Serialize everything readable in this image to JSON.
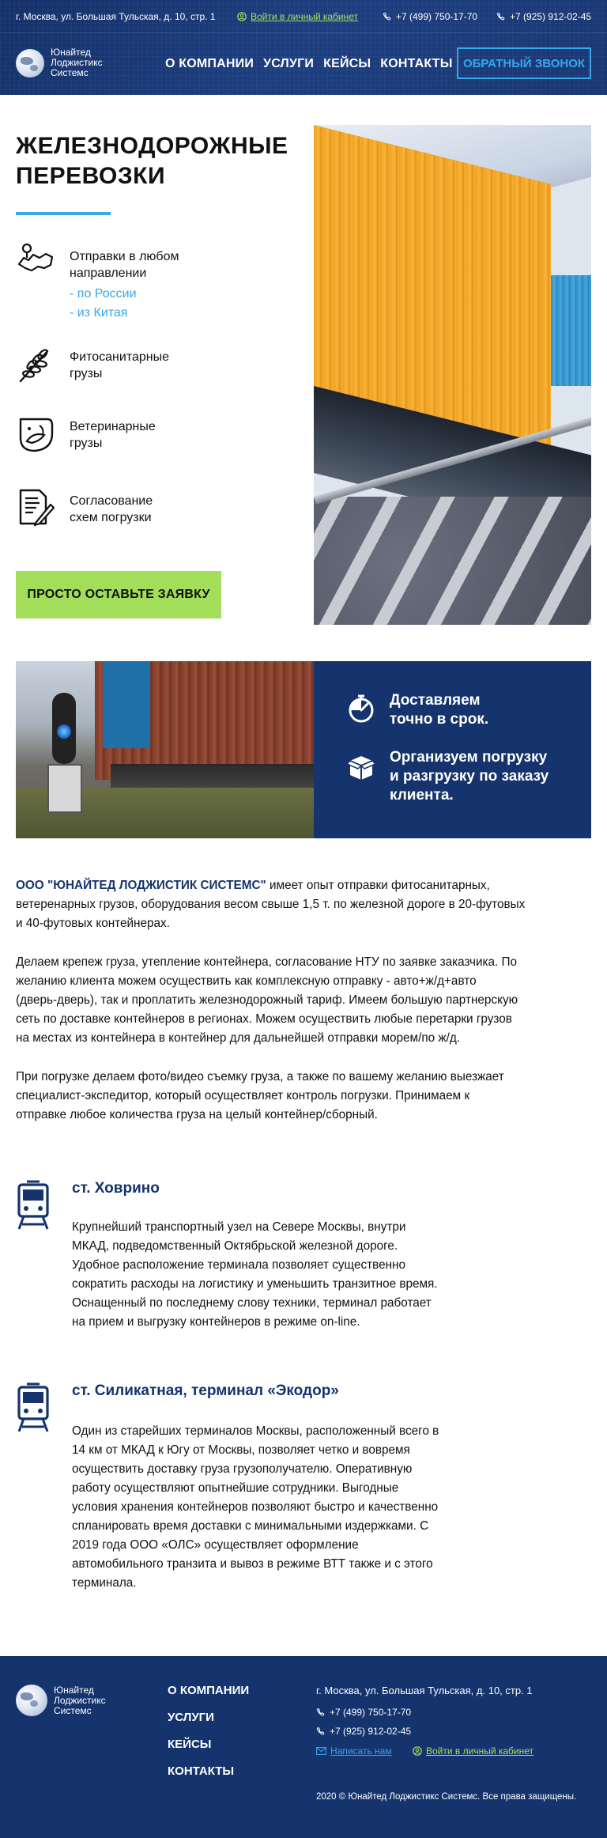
{
  "topbar": {
    "address": "г. Москва, ул. Большая Тульская, д. 10, стр. 1",
    "login": "Войти в личный кабинет",
    "phone1": "+7 (499) 750-17-70",
    "phone2": "+7 (925) 912-02-45"
  },
  "logo": {
    "line1": "Юнайтед",
    "line2": "Лоджистикс",
    "line3": "Системс"
  },
  "nav": [
    "О КОМПАНИИ",
    "УСЛУГИ",
    "КЕЙСЫ",
    "КОНТАКТЫ"
  ],
  "callback_button": "ОБРАТНЫЙ ЗВОНОК",
  "hero": {
    "title_line1": "ЖЕЛЕЗНОДОРОЖНЫЕ",
    "title_line2": "ПЕРЕВОЗКИ",
    "features": [
      {
        "icon": "map-icon",
        "line1": "Отправки в любом",
        "line2": "направлении",
        "sub1": "- по России",
        "sub2": "- из Китая"
      },
      {
        "icon": "wheat-icon",
        "line1": "Фитосанитарные",
        "line2": "грузы"
      },
      {
        "icon": "fish-icon",
        "line1": "Ветеринарные",
        "line2": "грузы"
      },
      {
        "icon": "document-icon",
        "line1": "Согласование",
        "line2": "схем погрузки"
      }
    ],
    "cta": "ПРОСТО ОСТАВЬТЕ ЗАЯВКУ"
  },
  "banner": {
    "item1_line1": "Доставляем",
    "item1_line2": "точно в срок.",
    "item2_line1": "Организуем погрузку",
    "item2_line2": "и разгрузку по заказу",
    "item2_line3": "клиента."
  },
  "text": {
    "p1_brand": "ООО \"ЮНАЙТЕД ЛОДЖИСТИК СИСТЕМС\"",
    "p1_line1_rest": " имеет опыт отправки фитосанитарных,",
    "p1_line2": "ветеренарных грузов, оборудования весом свыше 1,5 т. по железной дороге в 20-футовых",
    "p1_line3": "и 40-футовых контейнерах.",
    "p2_line1": "Делаем крепеж груза, утепление контейнера, согласование НТУ по заявке заказчика. По",
    "p2_line2": "желанию клиента можем осуществить как комплексную отправку - авто+ж/д+авто",
    "p2_line3": "(дверь-дверь), так и проплатить железнодорожный тариф. Имеем большую партнерскую",
    "p2_line4": "сеть по доставке контейнеров в регионах. Можем осуществить любые перетарки грузов",
    "p2_line5": "на местах из контейнера в контейнер для дальнейшей отправки морем/по ж/д.",
    "p3_line1": "При погрузке делаем фото/видео съемку груза, а также по вашему желанию выезжает",
    "p3_line2": "специалист-экспедитор, который осуществляет контроль погрузки. Принимаем к",
    "p3_line3": "отправке любое количества груза на целый контейнер/сборный."
  },
  "stations": [
    {
      "title": "ст. Ховрино",
      "lines": [
        "Крупнейший транспортный узел на Севере Москвы, внутри",
        "МКАД, подведомственный Октябрьской железной дороге.",
        "Удобное расположение терминала позволяет существенно",
        "сократить расходы на логистику и уменьшить транзитное время.",
        "Оснащенный по последнему слову техники, терминал работает",
        "на прием и выгрузку контейнеров в режиме on-line."
      ]
    },
    {
      "title": "ст. Силикатная, терминал «Экодор»",
      "lines": [
        "Один из старейших терминалов Москвы, расположенный всего в",
        "14 км от МКАД к Югу от Москвы, позволяет четко и вовремя",
        "осуществить доставку груза грузополучателю. Оперативную",
        "работу осуществляют опытнейшие сотрудники. Выгодные",
        "условия хранения контейнеров позволяют быстро и качественно",
        "спланировать время доставки с минимальными издержками. С",
        "2019 года ООО «ОЛС» осуществляет оформление",
        "автомобильного транзита и вывоз в режиме ВТТ также и с этого",
        "терминала."
      ]
    }
  ],
  "footer": {
    "nav": [
      "О КОМПАНИИ",
      "УСЛУГИ",
      "КЕЙСЫ",
      "КОНТАКТЫ"
    ],
    "address": "г. Москва, ул. Большая Тульская, д. 10, стр. 1",
    "phone1": "+7 (499) 750-17-70",
    "phone2": "+7 (925) 912-02-45",
    "write_us": "Написать нам",
    "login": "Войти в личный кабинет",
    "copyright": "2020 © Юнайтед Лоджистикс Системс. Все права защищены."
  },
  "colors": {
    "navy": "#15336c",
    "accent_blue": "#37a8e8",
    "accent_green": "#a3de5a"
  }
}
